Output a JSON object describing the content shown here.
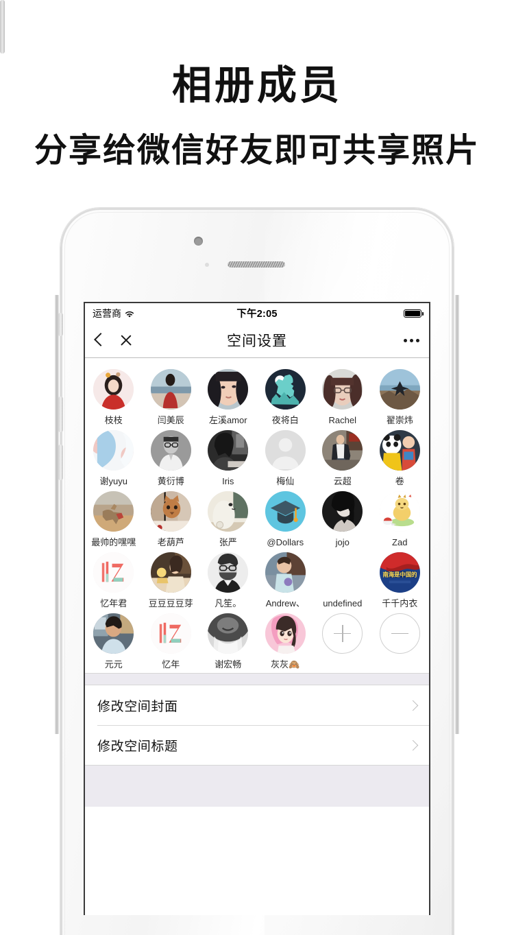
{
  "promo": {
    "headline": "相册成员",
    "subheadline": "分享给微信好友即可共享照片"
  },
  "status_bar": {
    "carrier": "运营商",
    "wifi_icon": "wifi-icon",
    "time": "下午2:05",
    "battery_icon": "battery-full-icon"
  },
  "nav_bar": {
    "back_icon": "back-chevron-icon",
    "close_icon": "close-icon",
    "title": "空间设置",
    "more_icon": "more-dots-icon"
  },
  "members": {
    "rows": [
      [
        {
          "name": "枝枝",
          "avatar": "photo-girl-red-jacket"
        },
        {
          "name": "闫美辰",
          "avatar": "photo-beach-red-dress"
        },
        {
          "name": "左溪amor",
          "avatar": "photo-girl-selfie"
        },
        {
          "name": "夜将白",
          "avatar": "illustration-llama-night"
        },
        {
          "name": "Rachel",
          "avatar": "photo-girl-glasses"
        },
        {
          "name": "翟崇炜",
          "avatar": "photo-jump-mountain"
        }
      ],
      [
        {
          "name": "谢yuyu",
          "avatar": "photo-collage-blue"
        },
        {
          "name": "黄衍博",
          "avatar": "photo-man-glasses-bw"
        },
        {
          "name": "Iris",
          "avatar": "photo-girl-reading-bw"
        },
        {
          "name": "梅仙",
          "avatar": "default-user-placeholder"
        },
        {
          "name": "云超",
          "avatar": "photo-man-street"
        },
        {
          "name": "卷",
          "avatar": "photo-panda-mascot"
        }
      ],
      [
        {
          "name": "最帅的嘿嘿",
          "avatar": "photo-camel-desert"
        },
        {
          "name": "老葫芦",
          "avatar": "photo-cat"
        },
        {
          "name": "张严",
          "avatar": "illustration-polar-bear"
        },
        {
          "name": "@Dollars",
          "avatar": "icon-graduation-cap"
        },
        {
          "name": "jojo",
          "avatar": "photo-woman-bw"
        },
        {
          "name": "Zad",
          "avatar": "illustration-yellow-mascot"
        }
      ],
      [
        {
          "name": "忆年君",
          "avatar": "logo-yi-gradient"
        },
        {
          "name": "豆豆豆豆芽",
          "avatar": "photo-girl-desk-warm"
        },
        {
          "name": "凡笙。",
          "avatar": "photo-man-mask-bw"
        },
        {
          "name": "Andrew、",
          "avatar": "photo-baby"
        },
        {
          "name": "undefined",
          "avatar": "none"
        },
        {
          "name": "千千内衣",
          "avatar": "image-flag-blue"
        }
      ],
      [
        {
          "name": "元元",
          "avatar": "photo-man-office"
        },
        {
          "name": "忆年",
          "avatar": "logo-yi-gradient"
        },
        {
          "name": "谢宏畅",
          "avatar": "photo-face-closeup-bw"
        },
        {
          "name": "灰灰🙈",
          "avatar": "illustration-anime-girl-pink"
        }
      ]
    ],
    "add_button_label": "+",
    "remove_button_label": "−"
  },
  "settings_list": [
    {
      "label": "修改空间封面",
      "chevron": "chevron-right-icon"
    },
    {
      "label": "修改空间标题",
      "chevron": "chevron-right-icon"
    }
  ],
  "colors": {
    "screen_bg": "#ffffff",
    "band": "#eceaf0",
    "divider": "#d9d9d9",
    "text_primary": "#111111",
    "text_secondary": "#2b2b2b",
    "chevron": "#bdbdbd",
    "circle_outline": "#cfcfcf"
  }
}
